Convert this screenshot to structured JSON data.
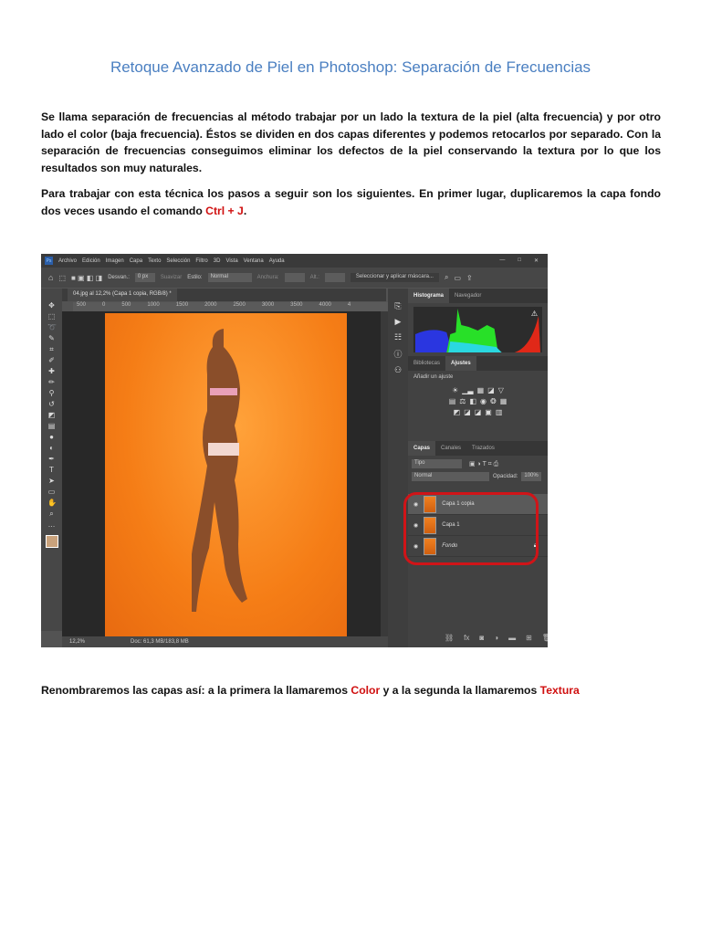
{
  "title": "Retoque Avanzado de Piel en Photoshop: Separación de Frecuencias",
  "paragraph1": "Se llama separación de frecuencias al método trabajar por un lado la textura de la piel (alta frecuencia) y por otro lado el color (baja frecuencia). Éstos se dividen en dos capas diferentes y podemos retocarlos por separado. Con la separación de frecuencias conseguimos eliminar los defectos de la piel conservando la textura por lo que los resultados son muy naturales.",
  "paragraph2": {
    "before": "Para trabajar con esta técnica los pasos a seguir son los siguientes. En primer lugar, duplicaremos la capa fondo dos veces usando el comando ",
    "highlight": "Ctrl + J",
    "after": "."
  },
  "paragraph3": {
    "before": "Renombraremos las capas así: a la primera la llamaremos ",
    "name1": "Color",
    "middle": " y a la segunda la llamaremos ",
    "name2": "Textura"
  },
  "photoshop": {
    "menu": [
      "Archivo",
      "Edición",
      "Imagen",
      "Capa",
      "Texto",
      "Selección",
      "Filtro",
      "3D",
      "Vista",
      "Ventana",
      "Ayuda"
    ],
    "options": {
      "desv_label": "Desvan.:",
      "desv_value": "0 px",
      "suavizar": "Suavizar",
      "estilo_label": "Estilo:",
      "estilo_value": "Normal",
      "anchura": "Anchura:",
      "altura": "Alt.:",
      "mask_button": "Seleccionar y aplicar máscara..."
    },
    "doc_tab": "04.jpg al 12,2% (Capa 1 copia, RGB/8) *",
    "ruler": [
      "500",
      "0",
      "500",
      "1000",
      "1500",
      "2000",
      "2500",
      "3000",
      "3500",
      "4000",
      "4"
    ],
    "zoom": "12,2%",
    "doc_info": "Doc: 61,3 MB/183,8 MB",
    "panel_tabs1": [
      "Histograma",
      "Navegador"
    ],
    "panel_tabs2": [
      "Bibliotecas",
      "Ajustes"
    ],
    "add_adjustment": "Añadir un ajuste",
    "panel_tabs3": [
      "Capas",
      "Canales",
      "Trazados"
    ],
    "filter": "Tipo",
    "blend_mode": "Normal",
    "opacity_label": "Opacidad:",
    "opacity_value": "100%",
    "layers": [
      "Capa 1 copia",
      "Capa 1",
      "Fondo"
    ]
  }
}
